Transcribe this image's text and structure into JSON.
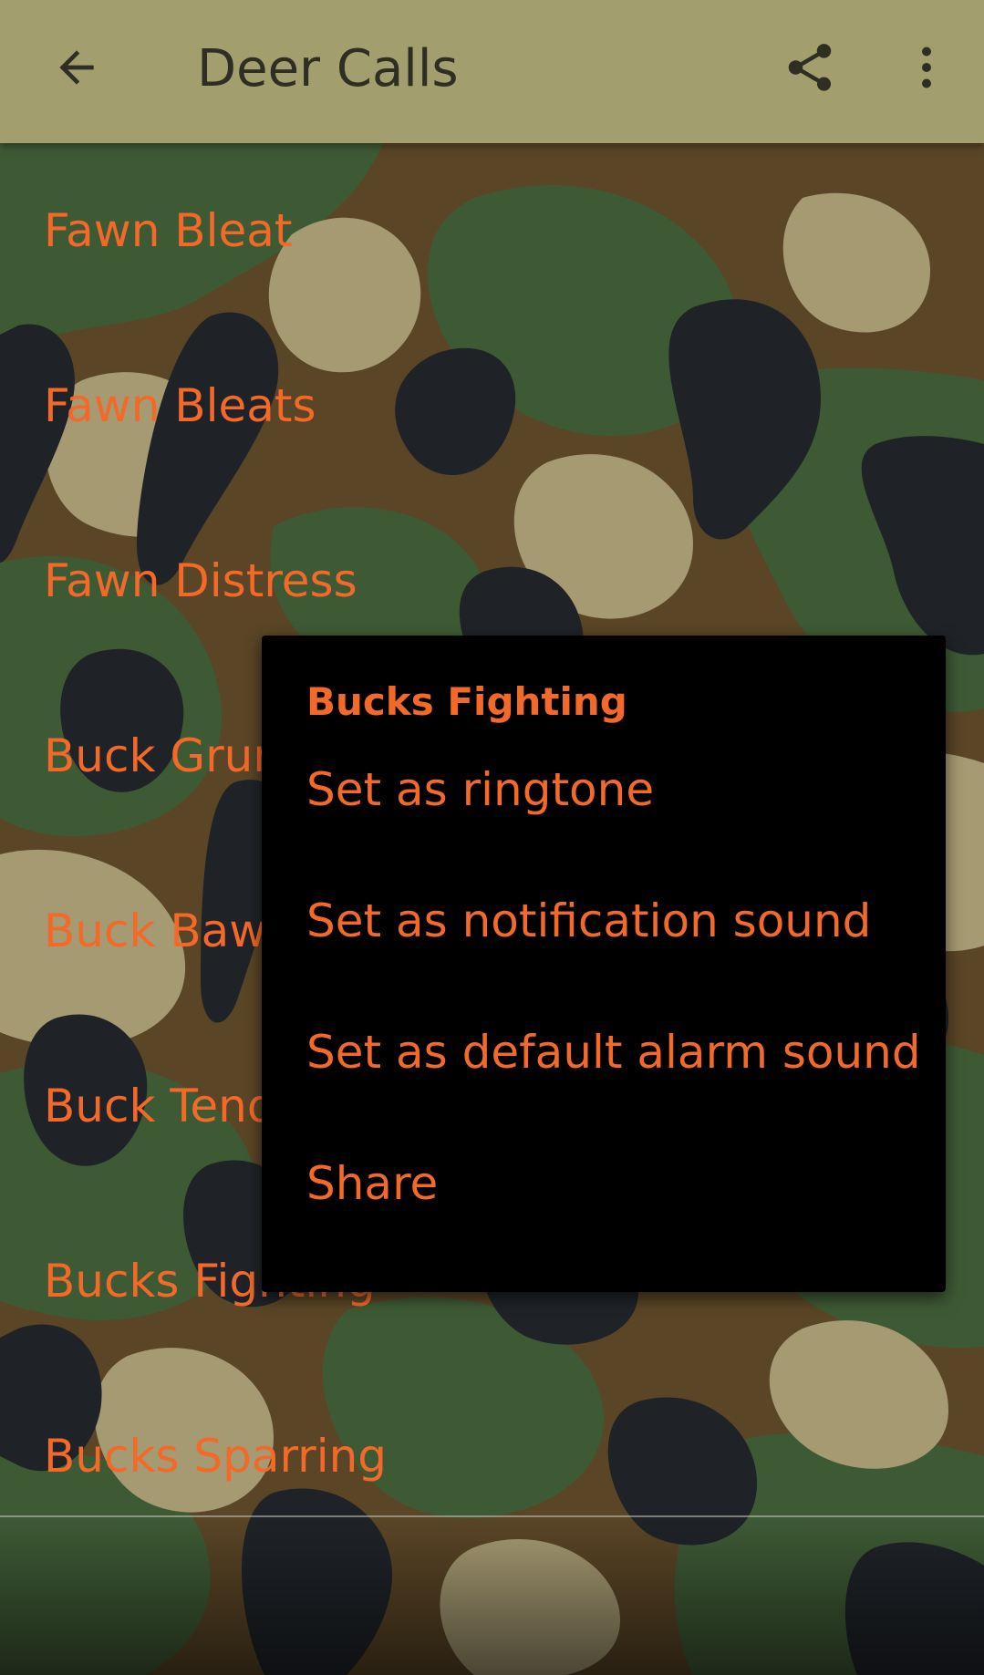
{
  "app_bar": {
    "title": "Deer Calls",
    "back_icon": "arrow-left-icon",
    "share_icon": "share-icon",
    "menu_icon": "more-vert-icon"
  },
  "list": {
    "items": [
      {
        "label": "Fawn Bleat"
      },
      {
        "label": "Fawn Bleats"
      },
      {
        "label": "Fawn Distress"
      },
      {
        "label": "Buck Grunt"
      },
      {
        "label": "Buck Bawl"
      },
      {
        "label": "Buck Tending"
      },
      {
        "label": "Bucks Fighting"
      },
      {
        "label": "Bucks Sparring"
      }
    ]
  },
  "context_menu": {
    "title": "Bucks Fighting",
    "items": [
      {
        "label": "Set as ringtone"
      },
      {
        "label": "Set as notification sound"
      },
      {
        "label": "Set as default alarm sound"
      },
      {
        "label": "Share"
      }
    ]
  },
  "colors": {
    "app_bar": "#a39e6e",
    "accent_text": "#f2692a",
    "camo_dark": "#1f2328",
    "camo_green": "#3e5a35",
    "camo_brown": "#5a4526",
    "camo_tan": "#a69a72"
  }
}
